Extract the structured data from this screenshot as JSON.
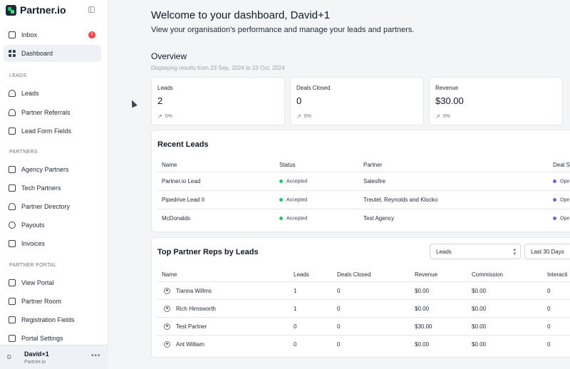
{
  "brand": {
    "name": "Partner.io"
  },
  "sidebar": {
    "items_top": [
      {
        "label": "Inbox",
        "icon": "inbox-icon",
        "badge": "5"
      },
      {
        "label": "Dashboard",
        "icon": "dashboard-icon",
        "active": true
      }
    ],
    "sections": [
      {
        "label": "LEADS",
        "items": [
          {
            "label": "Leads",
            "icon": "person-icon"
          },
          {
            "label": "Partner Referrals",
            "icon": "referral-icon"
          },
          {
            "label": "Lead Form Fields",
            "icon": "form-icon"
          }
        ]
      },
      {
        "label": "PARTNERS",
        "items": [
          {
            "label": "Agency Partners",
            "icon": "building-icon"
          },
          {
            "label": "Tech Partners",
            "icon": "monitor-icon"
          },
          {
            "label": "Partner Directory",
            "icon": "person-icon"
          },
          {
            "label": "Payouts",
            "icon": "dollar-icon"
          },
          {
            "label": "Invoices",
            "icon": "file-icon"
          }
        ]
      },
      {
        "label": "PARTNER PORTAL",
        "items": [
          {
            "label": "View Portal",
            "icon": "external-link-icon"
          },
          {
            "label": "Partner Room",
            "icon": "file-icon"
          },
          {
            "label": "Registration Fields",
            "icon": "form-icon"
          },
          {
            "label": "Portal Settings",
            "icon": "settings-icon"
          }
        ]
      }
    ],
    "user": {
      "avatar": "D",
      "name": "David+1",
      "org": "Partner.io",
      "more": "•••"
    }
  },
  "header": {
    "welcome": "Welcome to your dashboard, David+1",
    "subtitle": "View your organisation's performance and manage your leads and partners."
  },
  "overview": {
    "title": "Overview",
    "range": "Displaying results from 23 Sep, 2024 to 23 Oct, 2024",
    "stats": [
      {
        "label": "Leads",
        "value": "2",
        "change": "0%"
      },
      {
        "label": "Deals Closed",
        "value": "0",
        "change": "0%"
      },
      {
        "label": "Revenue",
        "value": "$30.00",
        "change": "0%"
      }
    ]
  },
  "recent_leads": {
    "title": "Recent Leads",
    "columns": [
      "Name",
      "Status",
      "Partner",
      "Deal S"
    ],
    "rows": [
      {
        "name": "Partner.io Lead",
        "status": "Accepted",
        "partner": "Salesfire",
        "deal": "Ope"
      },
      {
        "name": "Pipedrive Lead II",
        "status": "Accepted",
        "partner": "Treutel, Reynolds and Klocko",
        "deal": "Ope"
      },
      {
        "name": "McDonalds",
        "status": "Accepted",
        "partner": "Test Agency",
        "deal": "Ope"
      }
    ]
  },
  "top_reps": {
    "title": "Top Partner Reps by Leads",
    "metric_select": "Leads",
    "period_select": "Last 30 Days",
    "columns": [
      "Name",
      "Leads",
      "Deals Closed",
      "Revenue",
      "Commission",
      "Interacti"
    ],
    "rows": [
      {
        "name": "Tianna Willms",
        "leads": "1",
        "deals": "0",
        "revenue": "$0.00",
        "commission": "$0.00",
        "interactions": "0"
      },
      {
        "name": "Rich Himsworth",
        "leads": "1",
        "deals": "0",
        "revenue": "$0.00",
        "commission": "$0.00",
        "interactions": "0"
      },
      {
        "name": "Test Partner",
        "leads": "0",
        "deals": "0",
        "revenue": "$30.00",
        "commission": "$0.00",
        "interactions": "0"
      },
      {
        "name": "Ant William",
        "leads": "0",
        "deals": "0",
        "revenue": "$0.00",
        "commission": "$0.00",
        "interactions": "0"
      }
    ]
  }
}
